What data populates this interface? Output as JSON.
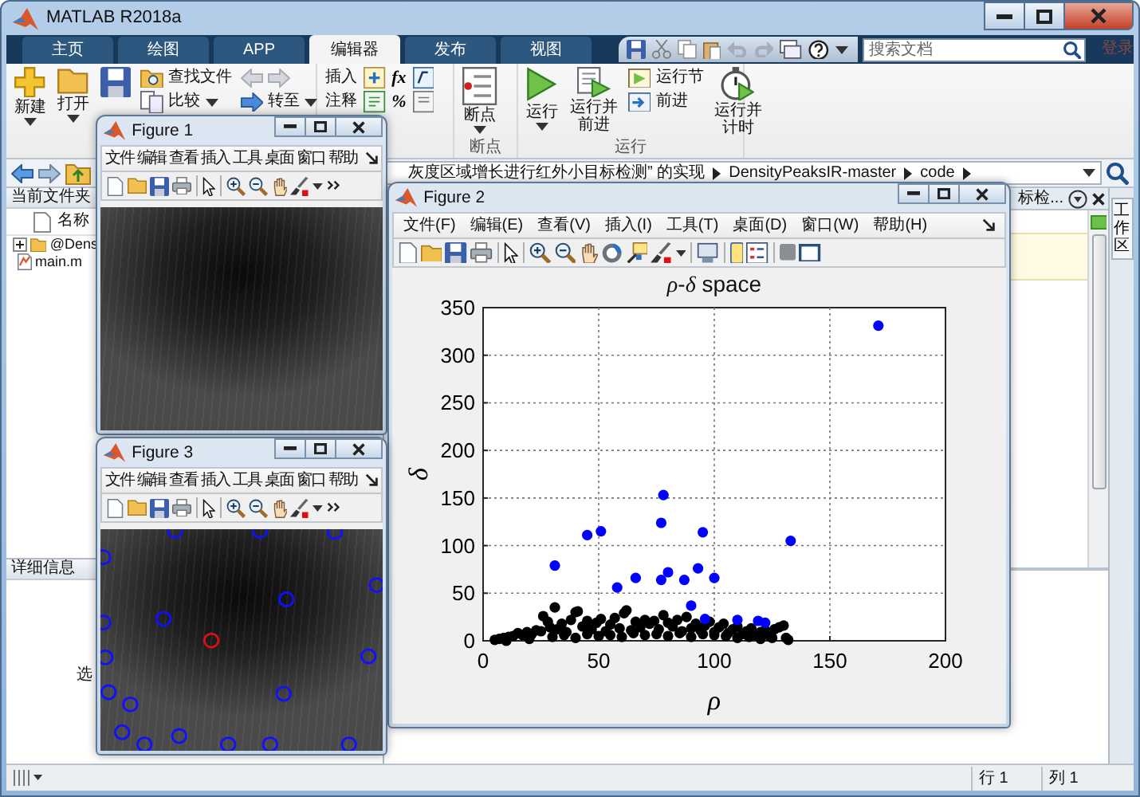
{
  "window": {
    "title": "MATLAB R2018a"
  },
  "tabs": [
    {
      "label": "主页",
      "selected": false
    },
    {
      "label": "绘图",
      "selected": false
    },
    {
      "label": "APP",
      "selected": false
    },
    {
      "label": "编辑器",
      "selected": true
    },
    {
      "label": "发布",
      "selected": false
    },
    {
      "label": "视图",
      "selected": false
    }
  ],
  "search": {
    "placeholder": "搜索文档"
  },
  "sign_in": "登录",
  "ribbon": [
    {
      "items": [
        {
          "kind": "large",
          "label": "新建",
          "dropdown": true
        },
        {
          "kind": "large",
          "label": "打开",
          "dropdown": true
        },
        {
          "kind": "icon"
        },
        {
          "kind": "stack",
          "rows": [
            {
              "kind": "button",
              "label": "查找文件",
              "dropdown": false
            },
            {
              "kind": "button",
              "label": "比较",
              "dropdown": true
            }
          ]
        },
        {
          "kind": "stack",
          "rows": [
            {
              "kind": "nav"
            },
            {
              "kind": "button",
              "label": "转至",
              "dropdown": true
            }
          ]
        }
      ]
    },
    {
      "items": [
        {
          "kind": "stack",
          "rows": [
            {
              "kind": "symbol",
              "label": "插入",
              "symbol": "fx"
            },
            {
              "kind": "symbol",
              "label": "注释",
              "symbol": "%"
            }
          ]
        }
      ]
    },
    {
      "label": "断点",
      "items": [
        {
          "kind": "large",
          "label": "断点",
          "dropdown": true
        }
      ]
    },
    {
      "label": "运行",
      "items": [
        {
          "kind": "large",
          "label": "运行",
          "dropdown": true
        },
        {
          "kind": "large",
          "label": "运行并前进",
          "dropdown": false
        },
        {
          "kind": "stack",
          "rows": [
            {
              "kind": "button",
              "label": "运行节",
              "dropdown": false
            },
            {
              "kind": "button",
              "label": "前进",
              "dropdown": false
            }
          ]
        },
        {
          "kind": "large",
          "label": "运行并计时",
          "dropdown": false
        }
      ]
    }
  ],
  "address_bar": {
    "path": [
      "灰度区域增长进行红外小目标检测” 的实现",
      "DensityPeaksIR-master",
      "code"
    ]
  },
  "current_folder": {
    "title": "当前文件夹",
    "column": "名称",
    "items": [
      {
        "kind": "folder",
        "name": "@Dens",
        "expanded": false
      },
      {
        "kind": "file",
        "name": "main.m"
      }
    ]
  },
  "details": {
    "title": "详细信息",
    "text": "选"
  },
  "editor": {
    "tab": "标检..."
  },
  "workspace": {
    "title": "工作区"
  },
  "status_bar": {
    "row": "行 1",
    "column": "列 1"
  },
  "figures": [
    {
      "title": "Figure 1",
      "kind": "image",
      "menu": [
        "文件",
        "编辑",
        "查看",
        "插入",
        "工具",
        "桌面",
        "窗口",
        "帮助"
      ]
    },
    {
      "title": "Figure 2",
      "kind": "chart",
      "menu": [
        "文件(F)",
        "编辑(E)",
        "查看(V)",
        "插入(I)",
        "工具(T)",
        "桌面(D)",
        "窗口(W)",
        "帮助(H)"
      ],
      "chart_data": {
        "type": "scatter",
        "title": "*ρ*-*δ* space",
        "xlabel": "ρ",
        "ylabel": "δ",
        "xlim": [
          0,
          200
        ],
        "ylim": [
          0,
          350
        ],
        "xticks": [
          0,
          50,
          100,
          150,
          200
        ],
        "yticks": [
          0,
          50,
          100,
          150,
          200,
          250,
          300,
          350
        ],
        "grid": true,
        "series": [
          {
            "color": "#000000",
            "x": [
              5,
              7,
              9,
              10,
              11,
              13,
              15,
              17,
              19,
              20,
              21,
              23,
              25,
              26,
              28,
              29,
              30,
              31,
              32,
              34,
              35,
              36,
              38,
              40,
              40,
              41,
              43,
              45,
              45,
              47,
              49,
              50,
              51,
              53,
              55,
              55,
              57,
              59,
              60,
              61,
              62,
              64,
              65,
              66,
              68,
              70,
              70,
              72,
              74,
              75,
              76,
              78,
              80,
              80,
              82,
              84,
              85,
              86,
              88,
              90,
              90,
              92,
              94,
              95,
              96,
              98,
              100,
              100,
              102,
              104,
              105,
              106,
              108,
              110,
              110,
              112,
              114,
              115,
              116,
              118,
              120,
              120,
              122,
              124,
              125,
              126,
              128,
              130,
              131,
              132
            ],
            "values": [
              1,
              2,
              3,
              0,
              4,
              5,
              8,
              6,
              9,
              2,
              7,
              11,
              10,
              26,
              20,
              14,
              4,
              35,
              12,
              18,
              6,
              9,
              22,
              30,
              3,
              31,
              15,
              21,
              7,
              12,
              19,
              5,
              23,
              10,
              17,
              6,
              24,
              13,
              4,
              29,
              32,
              11,
              8,
              20,
              14,
              22,
              6,
              18,
              21,
              7,
              12,
              27,
              19,
              5,
              15,
              22,
              8,
              10,
              25,
              13,
              4,
              18,
              11,
              7,
              16,
              20,
              9,
              6,
              14,
              18,
              5,
              8,
              12,
              15,
              3,
              7,
              10,
              4,
              13,
              6,
              9,
              2,
              11,
              5,
              3,
              12,
              14,
              16,
              3,
              1
            ]
          },
          {
            "color": "#0000ff",
            "x": [
              171,
              31,
              45,
              51,
              58,
              66,
              77,
              77,
              78,
              80,
              87,
              90,
              93,
              95,
              96,
              100,
              110,
              119,
              122,
              133
            ],
            "values": [
              331,
              79,
              111,
              115,
              56,
              66,
              64,
              124,
              153,
              72,
              64,
              37,
              76,
              114,
              23,
              66,
              22,
              21,
              19,
              105
            ]
          }
        ]
      }
    },
    {
      "title": "Figure 3",
      "kind": "image_markers",
      "menu": [
        "文件",
        "编辑",
        "查看",
        "插入",
        "工具",
        "桌面",
        "窗口",
        "帮助"
      ]
    }
  ]
}
